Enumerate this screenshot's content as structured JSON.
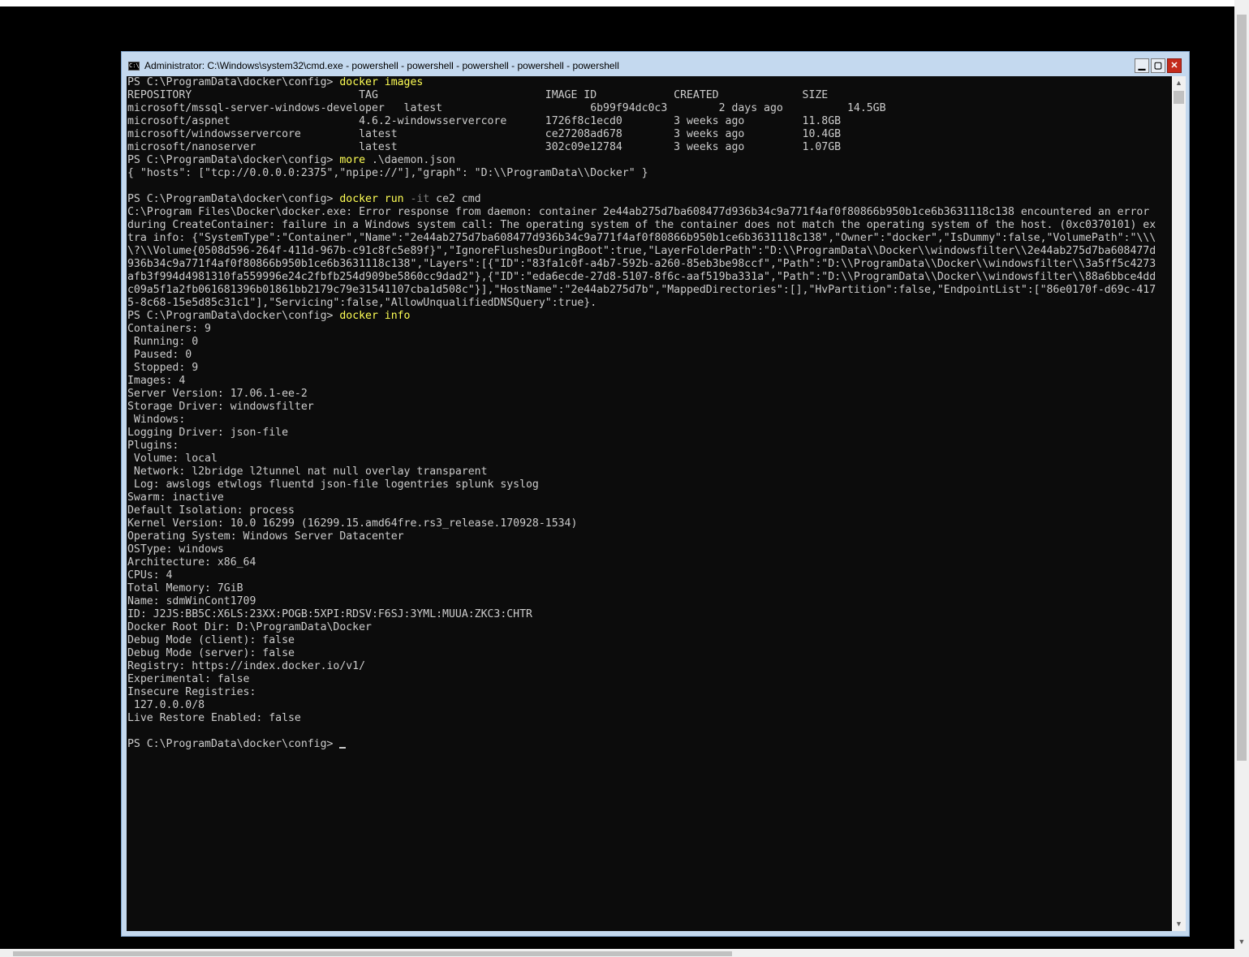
{
  "window": {
    "title": "Administrator: C:\\Windows\\system32\\cmd.exe - powershell - powershell - powershell - powershell - powershell",
    "icon": "cmd-icon",
    "controls": {
      "minimize": "minimize-icon",
      "maximize": "maximize-icon",
      "close": "close-icon"
    }
  },
  "console": {
    "prompt": "PS C:\\ProgramData\\docker\\config> ",
    "commands": {
      "images": "docker images",
      "more_cmd": "more",
      "more_arg": " .\\daemon.json",
      "run_cmd": "docker run",
      "run_flag": " -it",
      "run_arg": " ce2 cmd",
      "info": "docker info"
    },
    "images_output": [
      "REPOSITORY                          TAG                          IMAGE ID            CREATED             SIZE",
      "microsoft/mssql-server-windows-developer   latest                       6b99f94dc0c3        2 days ago          14.5GB",
      "microsoft/aspnet                    4.6.2-windowsservercore      1726f8c1ecd0        3 weeks ago         11.8GB",
      "microsoft/windowsservercore         latest                       ce27208ad678        3 weeks ago         10.4GB",
      "microsoft/nanoserver                latest                       302c09e12784        3 weeks ago         1.07GB"
    ],
    "daemon_output": [
      "{ \"hosts\": [\"tcp://0.0.0.0:2375\",\"npipe://\"],\"graph\": \"D:\\\\ProgramData\\\\Docker\" }",
      ""
    ],
    "run_output": [
      "C:\\Program Files\\Docker\\docker.exe: Error response from daemon: container 2e44ab275d7ba608477d936b34c9a771f4af0f80866b950b1ce6b3631118c138 encountered an error",
      "during CreateContainer: failure in a Windows system call: The operating system of the container does not match the operating system of the host. (0xc0370101) ex",
      "tra info: {\"SystemType\":\"Container\",\"Name\":\"2e44ab275d7ba608477d936b34c9a771f4af0f80866b950b1ce6b3631118c138\",\"Owner\":\"docker\",\"IsDummy\":false,\"VolumePath\":\"\\\\\\",
      "\\?\\\\Volume{0508d596-264f-411d-967b-c91c8fc5e89f}\",\"IgnoreFlushesDuringBoot\":true,\"LayerFolderPath\":\"D:\\\\ProgramData\\\\Docker\\\\windowsfilter\\\\2e44ab275d7ba608477d",
      "936b34c9a771f4af0f80866b950b1ce6b3631118c138\",\"Layers\":[{\"ID\":\"83fa1c0f-a4b7-592b-a260-85eb3be98ccf\",\"Path\":\"D:\\\\ProgramData\\\\Docker\\\\windowsfilter\\\\3a5ff5c4273",
      "afb3f994d4981310fa559996e24c2fbfb254d909be5860cc9dad2\"},{\"ID\":\"eda6ecde-27d8-5107-8f6c-aaf519ba331a\",\"Path\":\"D:\\\\ProgramData\\\\Docker\\\\windowsfilter\\\\88a6bbce4dd",
      "c09a5f1a2fb061681396b01861bb2179c79e31541107cba1d508c\"}],\"HostName\":\"2e44ab275d7b\",\"MappedDirectories\":[],\"HvPartition\":false,\"EndpointList\":[\"86e0170f-d69c-417",
      "5-8c68-15e5d85c31c1\"],\"Servicing\":false,\"AllowUnqualifiedDNSQuery\":true}."
    ],
    "info_output": [
      "Containers: 9",
      " Running: 0",
      " Paused: 0",
      " Stopped: 9",
      "Images: 4",
      "Server Version: 17.06.1-ee-2",
      "Storage Driver: windowsfilter",
      " Windows:",
      "Logging Driver: json-file",
      "Plugins:",
      " Volume: local",
      " Network: l2bridge l2tunnel nat null overlay transparent",
      " Log: awslogs etwlogs fluentd json-file logentries splunk syslog",
      "Swarm: inactive",
      "Default Isolation: process",
      "Kernel Version: 10.0 16299 (16299.15.amd64fre.rs3_release.170928-1534)",
      "Operating System: Windows Server Datacenter",
      "OSType: windows",
      "Architecture: x86_64",
      "CPUs: 4",
      "Total Memory: 7GiB",
      "Name: sdmWinCont1709",
      "ID: J2JS:BB5C:X6LS:23XX:POGB:5XPI:RDSV:F6SJ:3YML:MUUA:ZKC3:CHTR",
      "Docker Root Dir: D:\\ProgramData\\Docker",
      "Debug Mode (client): false",
      "Debug Mode (server): false",
      "Registry: https://index.docker.io/v1/",
      "Experimental: false",
      "Insecure Registries:",
      " 127.0.0.0/8",
      "Live Restore Enabled: false",
      ""
    ]
  },
  "scrollbar": {
    "up": "▲",
    "down": "▼"
  },
  "colors": {
    "console_bg": "#0c0c0c",
    "console_fg": "#cccccc",
    "command": "#ffff55",
    "flag": "#808080",
    "frame": "#c4d9ef",
    "close": "#c42b1c"
  }
}
